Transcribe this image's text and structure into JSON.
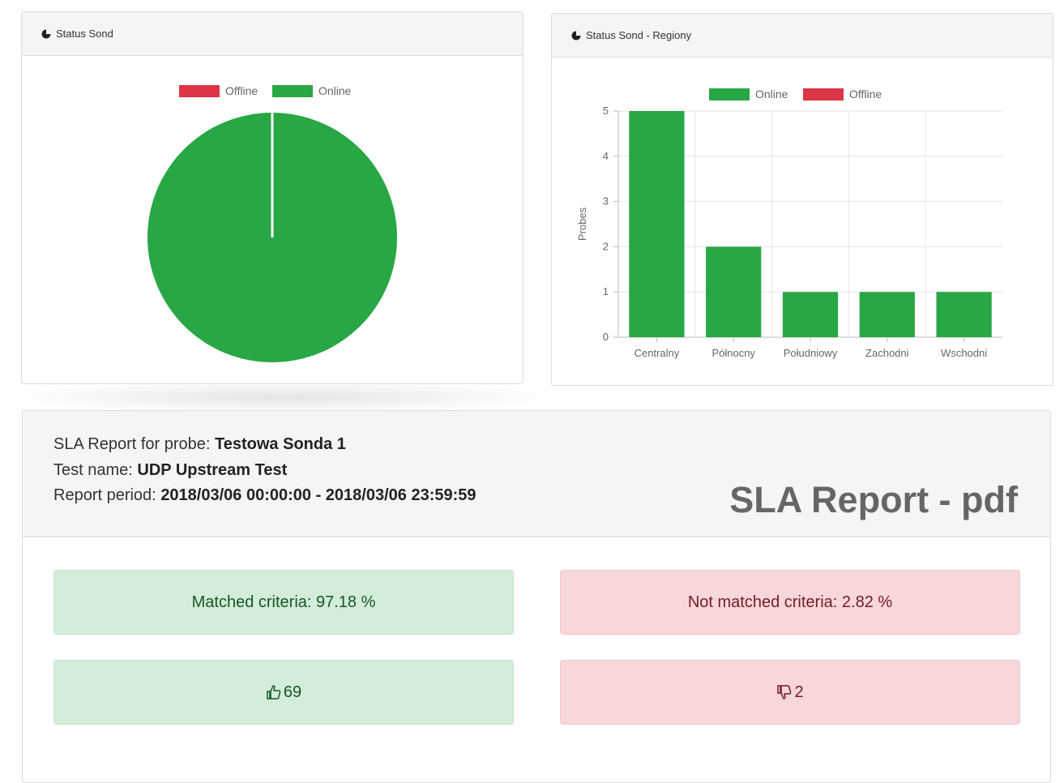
{
  "pie_panel": {
    "title": "Status Sond",
    "icon": "pie-chart-icon"
  },
  "bar_panel": {
    "title": "Status Sond - Regiony",
    "icon": "pie-chart-icon"
  },
  "colors": {
    "online": "#28a745",
    "offline": "#dc3545",
    "success_bg": "#d4edda",
    "danger_bg": "#f8d7da"
  },
  "chart_data": [
    {
      "type": "pie",
      "title": "Status Sond",
      "legend_position": "top",
      "series": [
        {
          "name": "Offline",
          "value": 0
        },
        {
          "name": "Online",
          "value": 100
        }
      ]
    },
    {
      "type": "bar",
      "title": "Status Sond - Regiony",
      "legend_position": "top",
      "categories": [
        "Centralny",
        "Północny",
        "Południowy",
        "Zachodni",
        "Wschodni"
      ],
      "series": [
        {
          "name": "Online",
          "values": [
            5,
            2,
            1,
            1,
            1
          ]
        },
        {
          "name": "Offline",
          "values": [
            0,
            0,
            0,
            0,
            0
          ]
        }
      ],
      "ylabel": "Probes",
      "ylim": [
        0,
        5
      ],
      "yticks": [
        "0",
        "1",
        "2",
        "3",
        "4",
        "5"
      ],
      "grid": true
    }
  ],
  "sla": {
    "probe_label": "SLA Report for probe:",
    "probe_value": "Testowa Sonda 1",
    "test_label": "Test name:",
    "test_value": "UDP Upstream Test",
    "period_label": "Report period:",
    "period_value": "2018/03/06 00:00:00 - 2018/03/06 23:59:59",
    "title": "SLA Report - pdf",
    "matched": "Matched criteria: 97.18 %",
    "not_matched": "Not matched criteria: 2.82 %",
    "thumbs_up_count": "69",
    "thumbs_down_count": "2",
    "thumbs_up_icon": "thumbs-up-icon",
    "thumbs_down_icon": "thumbs-down-icon"
  }
}
